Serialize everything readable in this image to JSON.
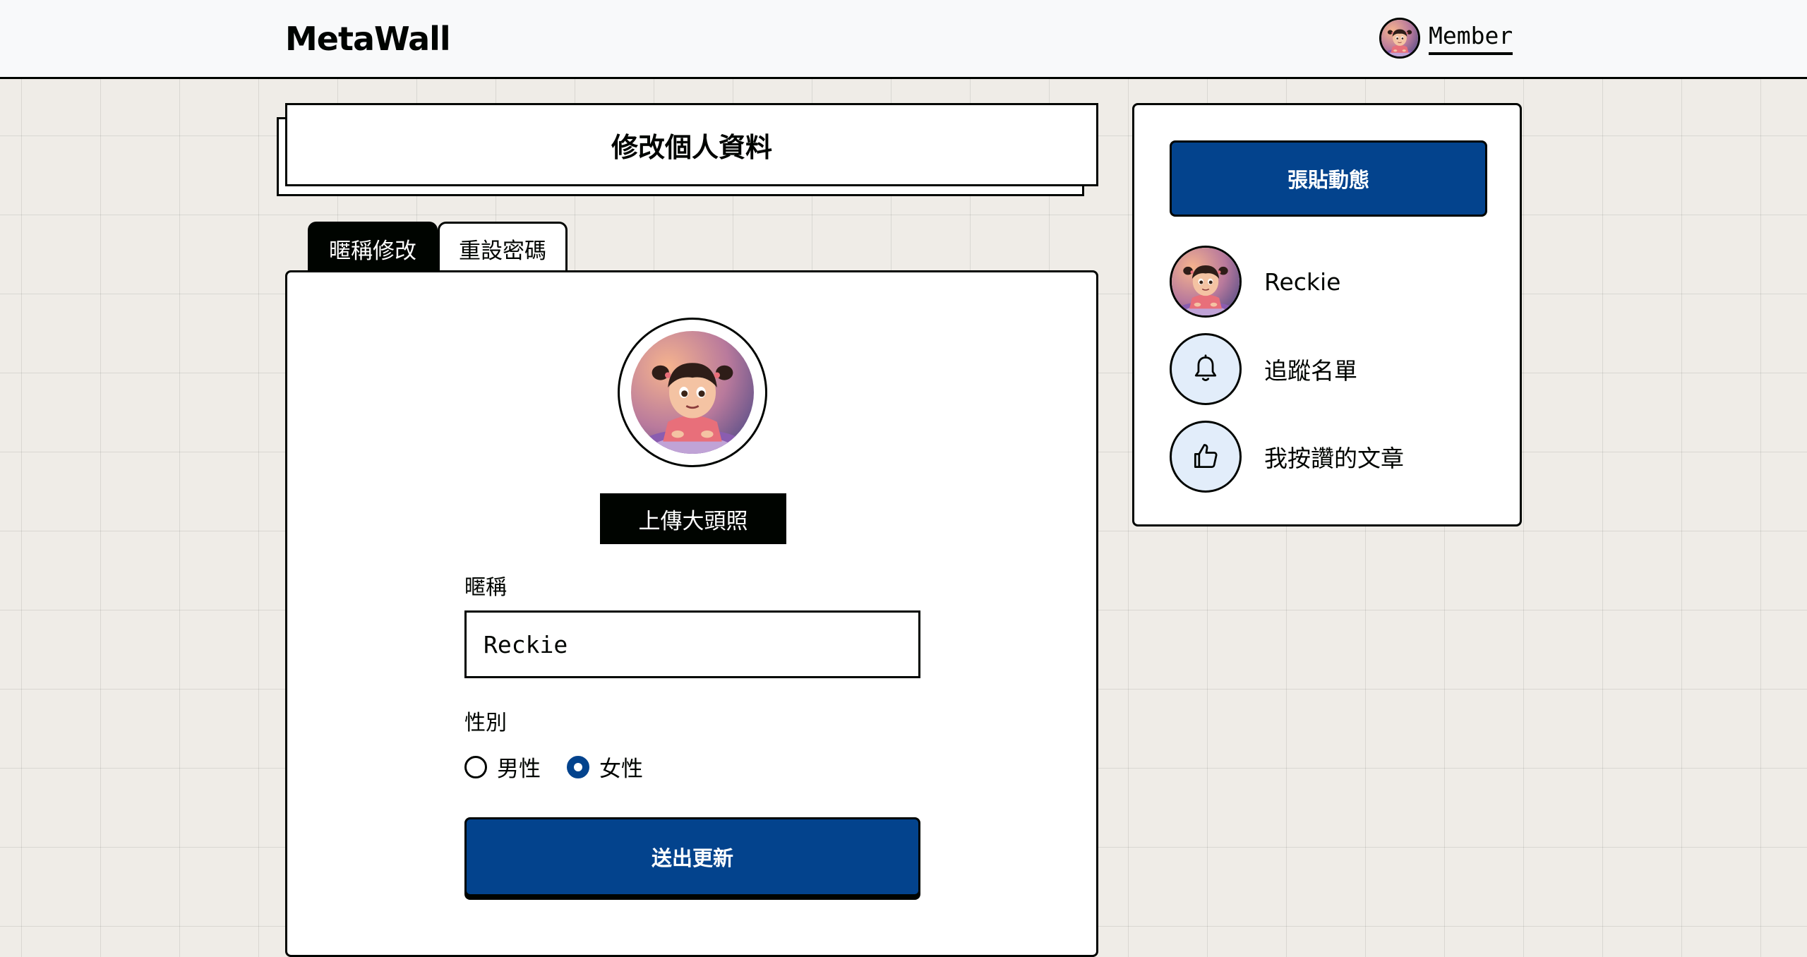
{
  "header": {
    "logo": "MetaWall",
    "member_label": "Member"
  },
  "title": "修改個人資料",
  "tabs": [
    {
      "label": "暱稱修改",
      "active": true
    },
    {
      "label": "重設密碼",
      "active": false
    }
  ],
  "form": {
    "upload_label": "上傳大頭照",
    "nickname_label": "暱稱",
    "nickname_value": "Reckie",
    "gender_label": "性別",
    "gender_options": [
      {
        "label": "男性",
        "checked": false
      },
      {
        "label": "女性",
        "checked": true
      }
    ],
    "submit_label": "送出更新"
  },
  "sidebar": {
    "post_button": "張貼動態",
    "items": [
      {
        "label": "Reckie",
        "icon": "avatar"
      },
      {
        "label": "追蹤名單",
        "icon": "bell-icon"
      },
      {
        "label": "我按讚的文章",
        "icon": "thumbs-up-icon"
      }
    ]
  },
  "colors": {
    "primary": "#03438d",
    "dark": "#000400",
    "background": "#efece7",
    "icon_bg": "#e2edfa"
  }
}
